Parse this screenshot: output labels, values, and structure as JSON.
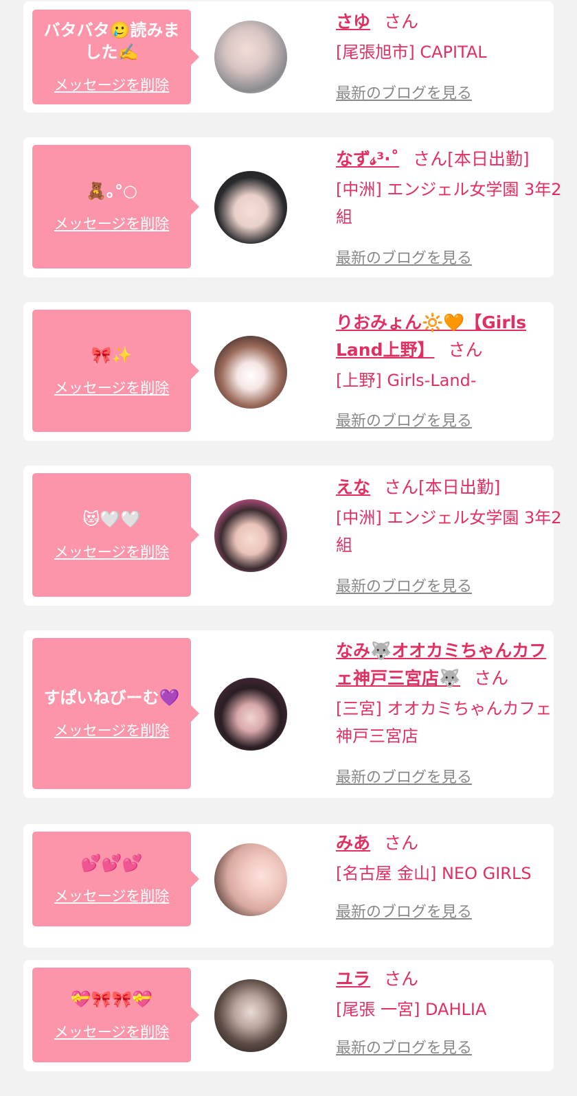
{
  "delete_label": "メッセージを削除",
  "honorific": "さん",
  "blog_label": "最新のブログを見る",
  "colors": {
    "background": "#f2f2f2",
    "card": "#ffffff",
    "bubble": "#fd95aa",
    "accent": "#e22f62",
    "link_gray": "#888888"
  },
  "items": [
    {
      "message": "バタバタ🥲読みました✍️",
      "name": "さゆ",
      "status": "",
      "shop": "[尾張旭市] CAPITAL",
      "avatar_icon": "avatar-photo"
    },
    {
      "message": "🧸｡°○",
      "name": "なず𝓈³·˚",
      "status": "[本日出勤]",
      "shop": "[中洲] エンジェル女学園 3年2組",
      "avatar_icon": "avatar-photo"
    },
    {
      "message": "🎀✨",
      "name": "りおみょん🔆🧡【Girls Land上野】",
      "status": "",
      "shop": "[上野] Girls-Land-",
      "avatar_icon": "avatar-photo"
    },
    {
      "message": "😻🤍🤍",
      "name": "えな",
      "status": "[本日出勤]",
      "shop": "[中洲] エンジェル女学園 3年2組",
      "avatar_icon": "avatar-photo"
    },
    {
      "message": "すぱいねびーむ💜",
      "name": "なみ🐺オオカミちゃんカフェ神戸三宮店🐺",
      "status": "",
      "shop": "[三宮] オオカミちゃんカフェ神戸三宮店",
      "avatar_icon": "avatar-photo"
    },
    {
      "message": "💕💕💕",
      "name": "みあ",
      "status": "",
      "shop": "[名古屋 金山] NEO GIRLS",
      "avatar_icon": "avatar-photo"
    },
    {
      "message": "💝🎀🎀💝",
      "name": "ユラ",
      "status": "",
      "shop": "[尾張 一宮] DAHLIA",
      "avatar_icon": "avatar-photo"
    }
  ]
}
